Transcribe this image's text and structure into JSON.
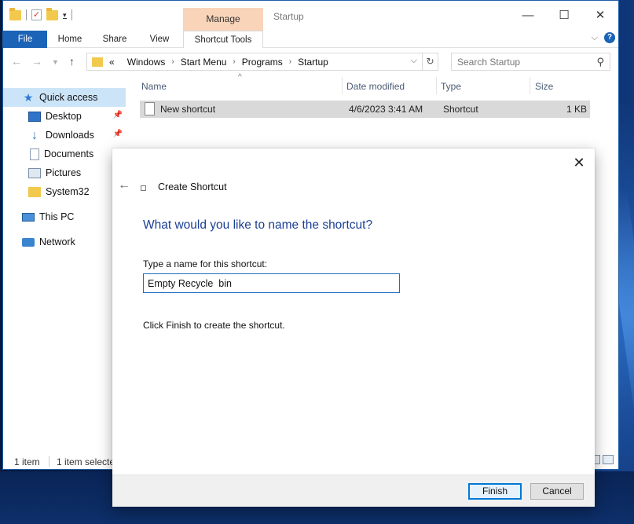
{
  "window": {
    "title": "Startup",
    "manage_label": "Manage",
    "controls": {
      "minimize": "—",
      "maximize": "☐",
      "close": "✕"
    }
  },
  "ribbon": {
    "tabs": [
      "File",
      "Home",
      "Share",
      "View"
    ],
    "tools_tab": "Shortcut Tools"
  },
  "address": {
    "overflow": "«",
    "crumbs": [
      "Windows",
      "Start Menu",
      "Programs",
      "Startup"
    ]
  },
  "search": {
    "placeholder": "Search Startup"
  },
  "navpane": {
    "items": [
      {
        "label": "Quick access",
        "icon": "star-icon",
        "pinned": false
      },
      {
        "label": "Desktop",
        "icon": "desktop-icon",
        "pinned": true
      },
      {
        "label": "Downloads",
        "icon": "download-icon",
        "pinned": true
      },
      {
        "label": "Documents",
        "icon": "documents-icon",
        "pinned": true
      },
      {
        "label": "Pictures",
        "icon": "pictures-icon",
        "pinned": false
      },
      {
        "label": "System32",
        "icon": "folder-icon",
        "pinned": false
      },
      {
        "label": "This PC",
        "icon": "computer-icon",
        "pinned": false
      },
      {
        "label": "Network",
        "icon": "network-icon",
        "pinned": false
      }
    ]
  },
  "columns": {
    "name": "Name",
    "date": "Date modified",
    "type": "Type",
    "size": "Size"
  },
  "files": [
    {
      "name": "New shortcut",
      "date": "4/6/2023 3:41 AM",
      "type": "Shortcut",
      "size": "1 KB"
    }
  ],
  "status": {
    "count": "1 item",
    "selected": "1 item selecte"
  },
  "dialog": {
    "title": "Create Shortcut",
    "heading": "What would you like to name the shortcut?",
    "label": "Type a name for this shortcut:",
    "input_value": "Empty Recycle  bin",
    "hint": "Click Finish to create the shortcut.",
    "finish": "Finish",
    "cancel": "Cancel"
  },
  "colors": {
    "accent": "#1a63b6",
    "manage_band": "#f9d4b9",
    "heading": "#1c3f94",
    "selection": "#cce4f7"
  }
}
